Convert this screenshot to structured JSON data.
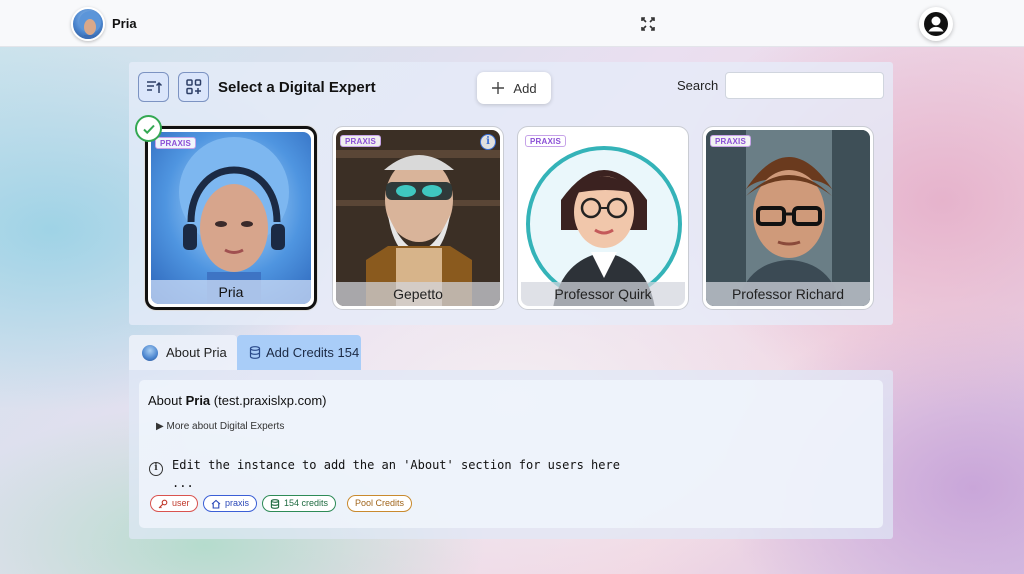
{
  "app": {
    "title": "Pria"
  },
  "panel": {
    "title": "Select a Digital Expert",
    "add_label": "Add",
    "search_label": "Search",
    "search_value": ""
  },
  "experts": [
    {
      "name": "Pria",
      "badge": "PRAXIS",
      "selected": true
    },
    {
      "name": "Gepetto",
      "badge": "PRAXIS",
      "selected": false
    },
    {
      "name": "Professor Quirk",
      "badge": "PRAXIS",
      "selected": false
    },
    {
      "name": "Professor Richard",
      "badge": "PRAXIS",
      "selected": false
    }
  ],
  "tabs": {
    "about_label": "About Pria",
    "credits_label": "Add Credits 154"
  },
  "about": {
    "prefix": "About ",
    "name": "Pria",
    "domain": "(test.praxislxp.com)",
    "details_label": "More about Digital Experts",
    "text_line1": "Edit the instance to add the an 'About' section for users here",
    "text_line2": "..."
  },
  "chips": {
    "user": "user",
    "praxis": "praxis",
    "credits": "154 credits",
    "pool": "Pool Credits"
  },
  "colors": {
    "accent": "#a9cdf8",
    "praxis_badge": "#8b4fd6",
    "selected_check": "#34a853"
  }
}
